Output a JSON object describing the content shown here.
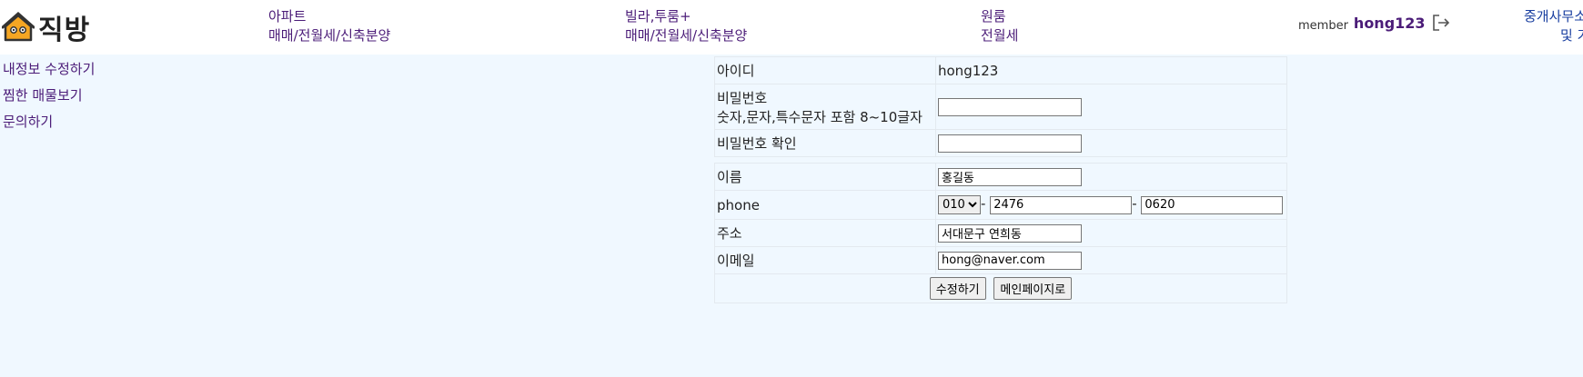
{
  "header": {
    "logo_text": "직방",
    "nav": [
      {
        "line1": "아파트",
        "line2": "매매/전월세/신축분양"
      },
      {
        "line1": "빌라,투룸+",
        "line2": "매매/전월세/신축분양"
      },
      {
        "line1": "원룸",
        "line2": "전월세"
      }
    ],
    "member_label": "member",
    "member_id": "hong123",
    "office_line1": "중개사무소",
    "office_line2": "및 가"
  },
  "side_menu": [
    "내정보 수정하기",
    "찜한 매물보기",
    "문의하기"
  ],
  "form": {
    "id_label": "아이디",
    "id_value": "hong123",
    "pw_label": "비밀번호",
    "pw_hint": "숫자,문자,특수문자 포함 8~10글자",
    "pw_confirm_label": "비밀번호 확인",
    "name_label": "이름",
    "name_value": "홍길동",
    "phone_label": "phone",
    "phone_prefix": "010",
    "phone_mid": "2476",
    "phone_last": "0620",
    "phone_sep": "-",
    "address_label": "주소",
    "address_value": "서대문구 연희동",
    "email_label": "이메일",
    "email_value": "hong@naver.com",
    "submit_label": "수정하기",
    "main_label": "메인페이지로"
  }
}
